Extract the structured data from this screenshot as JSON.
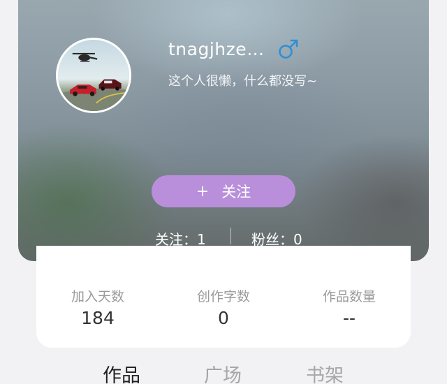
{
  "profile": {
    "username": "tnagjhze…",
    "gender_icon": "male-icon",
    "gender_color": "#2e8fd6",
    "bio": "这个人很懒，什么都没写~"
  },
  "follow_button": {
    "icon": "+",
    "label": "关注",
    "color": "#b98fdb"
  },
  "counts": {
    "following": "关注：1",
    "fans": "粉丝：0"
  },
  "stats": [
    {
      "label": "加入天数",
      "value": "184"
    },
    {
      "label": "创作字数",
      "value": "0"
    },
    {
      "label": "作品数量",
      "value": "--"
    }
  ],
  "tabs": [
    {
      "label": "作品",
      "active": true
    },
    {
      "label": "广场",
      "active": false
    },
    {
      "label": "书架",
      "active": false
    }
  ]
}
